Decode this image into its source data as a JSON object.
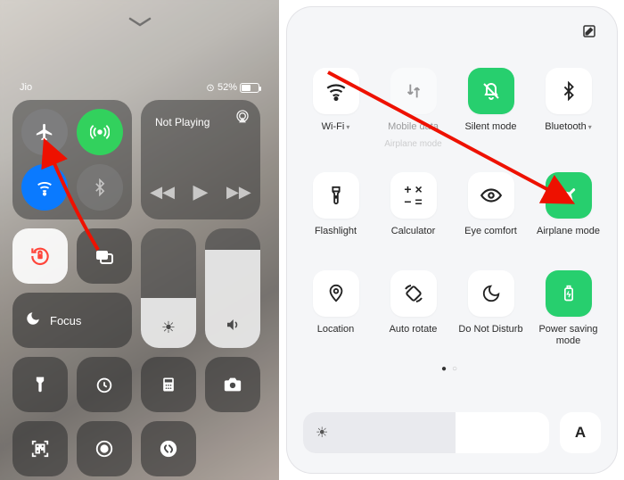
{
  "ios": {
    "carrier": "Jio",
    "battery_pct": "52%",
    "media_title": "Not Playing",
    "focus_label": "Focus"
  },
  "android": {
    "tiles": {
      "wifi": "Wi-Fi",
      "mobile": "Mobile data",
      "mobile_sub": "Airplane mode",
      "silent": "Silent mode",
      "bt": "Bluetooth",
      "flash": "Flashlight",
      "calc": "Calculator",
      "eye": "Eye comfort",
      "airplane": "Airplane mode",
      "location": "Location",
      "rotate": "Auto rotate",
      "dnd": "Do Not Disturb",
      "power": "Power saving mode"
    },
    "auto_label": "A"
  }
}
